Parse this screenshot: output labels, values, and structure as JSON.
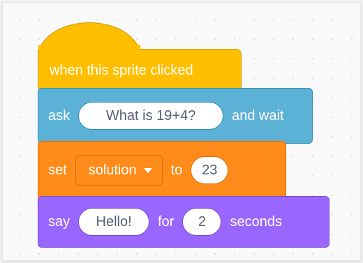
{
  "script": {
    "hat_block": {
      "label": "when this sprite clicked",
      "color": "#ffbf00"
    },
    "ask_block": {
      "label_before": "ask",
      "input_value": "What is 19+4?",
      "label_after": "and wait",
      "color": "#5cb1d6"
    },
    "set_block": {
      "label_before": "set",
      "variable": "solution",
      "label_mid": "to",
      "value": "23",
      "color": "#ff8c1a"
    },
    "say_block": {
      "label_before": "say",
      "message": "Hello!",
      "label_mid": "for",
      "duration": "2",
      "label_after": "seconds",
      "color": "#9966ff"
    }
  }
}
